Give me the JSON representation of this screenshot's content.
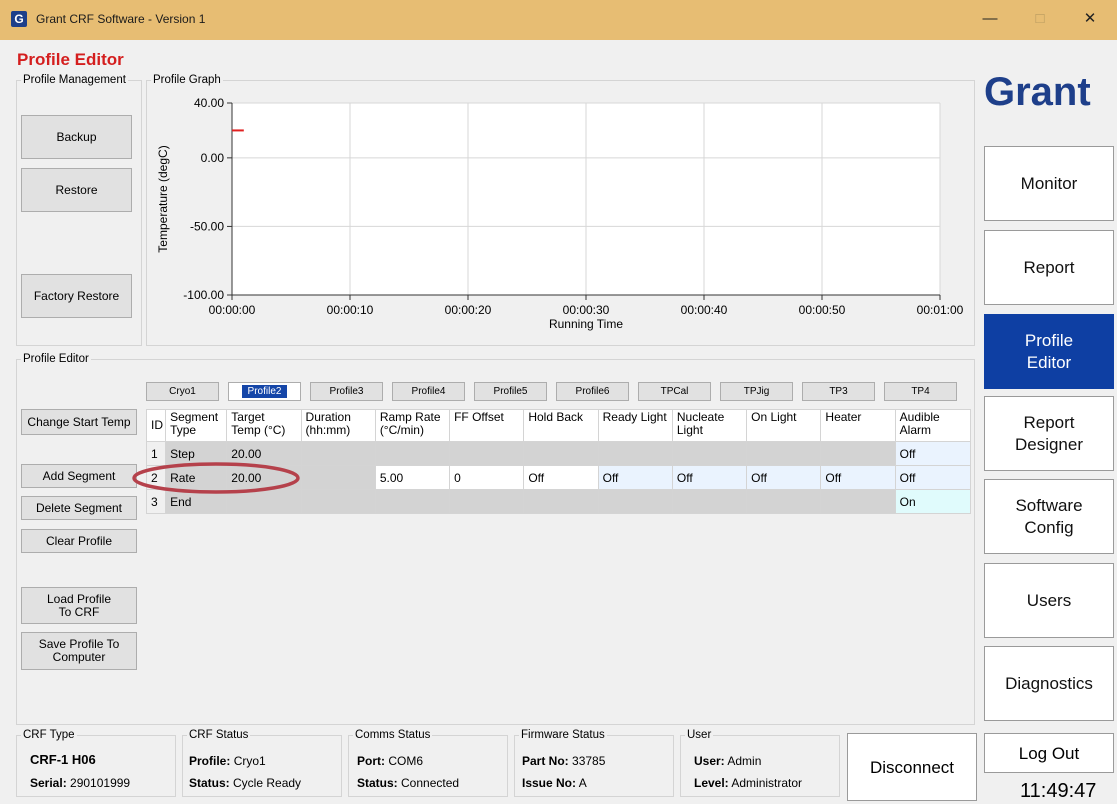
{
  "window": {
    "app_icon": "G",
    "title": "Grant CRF Software - Version 1",
    "minimize": "—",
    "maximize": "□",
    "close": "✕"
  },
  "header": {
    "title": "Profile Editor"
  },
  "profile_management": {
    "legend": "Profile Management",
    "backup": "Backup",
    "restore": "Restore",
    "factory_restore": "Factory Restore"
  },
  "graph": {
    "legend": "Profile Graph",
    "chart_data": {
      "type": "line",
      "title": "",
      "xlabel": "Running Time",
      "ylabel": "Temperature (degC)",
      "x_ticks": [
        "00:00:00",
        "00:00:10",
        "00:00:20",
        "00:00:30",
        "00:00:40",
        "00:00:50",
        "00:01:00"
      ],
      "y_ticks": [
        "40.00",
        "0.00",
        "-50.00",
        "-100.00"
      ],
      "xlim": [
        0,
        60
      ],
      "ylim": [
        -100,
        40
      ],
      "grid": true,
      "series": [
        {
          "color": "#e02020",
          "x": [
            0,
            1
          ],
          "y": [
            20,
            20
          ]
        }
      ]
    }
  },
  "editor": {
    "legend": "Profile Editor",
    "tabs": [
      "Cryo1",
      "Profile2",
      "Profile3",
      "Profile4",
      "Profile5",
      "Profile6",
      "TPCal",
      "TPJig",
      "TP3",
      "TP4"
    ],
    "active_tab": 1,
    "buttons": {
      "change_start_temp": "Change Start Temp",
      "add_segment": "Add Segment",
      "delete_segment": "Delete Segment",
      "clear_profile": "Clear Profile",
      "load_profile": "Load Profile To CRF",
      "save_profile": "Save Profile To Computer"
    },
    "columns": [
      "ID",
      "Segment Type",
      "Target Temp (°C)",
      "Duration (hh:mm)",
      "Ramp Rate (°C/min)",
      "FF Offset",
      "Hold Back",
      "Ready Light",
      "Nucleate Light",
      "On Light",
      "Heater",
      "Audible Alarm"
    ],
    "rows": [
      [
        "1",
        "Step",
        "20.00",
        "",
        "",
        "",
        "",
        "",
        "",
        "",
        "",
        "Off"
      ],
      [
        "2",
        "Rate",
        "20.00",
        "",
        "5.00",
        "0",
        "Off",
        "Off",
        "Off",
        "Off",
        "Off",
        "Off"
      ],
      [
        "3",
        "End",
        "",
        "",
        "",
        "",
        "",
        "",
        "",
        "",
        "",
        "On"
      ]
    ],
    "highlight_color": "#b5414b"
  },
  "nav": {
    "logo": "Grant",
    "items": [
      "Monitor",
      "Report",
      "Profile Editor",
      "Report Designer",
      "Software Config",
      "Users",
      "Diagnostics"
    ],
    "active": "Profile Editor",
    "accent": "#0e3fa3",
    "logo_color": "#1e3f8a"
  },
  "status": {
    "crf_type": {
      "legend": "CRF Type",
      "value": "CRF-1 H06",
      "serial_label": "Serial:",
      "serial": "290101999"
    },
    "crf_status": {
      "legend": "CRF Status",
      "profile_label": "Profile:",
      "profile": "Cryo1",
      "status_label": "Status:",
      "status": "Cycle Ready"
    },
    "comms": {
      "legend": "Comms Status",
      "port_label": "Port:",
      "port": "COM6",
      "status_label": "Status:",
      "status": "Connected"
    },
    "firmware": {
      "legend": "Firmware Status",
      "part_label": "Part No:",
      "part": "33785",
      "issue_label": "Issue No:",
      "issue": "A"
    },
    "user": {
      "legend": "User",
      "user_label": "User:",
      "user": "Admin",
      "level_label": "Level:",
      "level": "Administrator"
    },
    "disconnect": "Disconnect",
    "logout": "Log Out",
    "clock": "11:49:47"
  }
}
